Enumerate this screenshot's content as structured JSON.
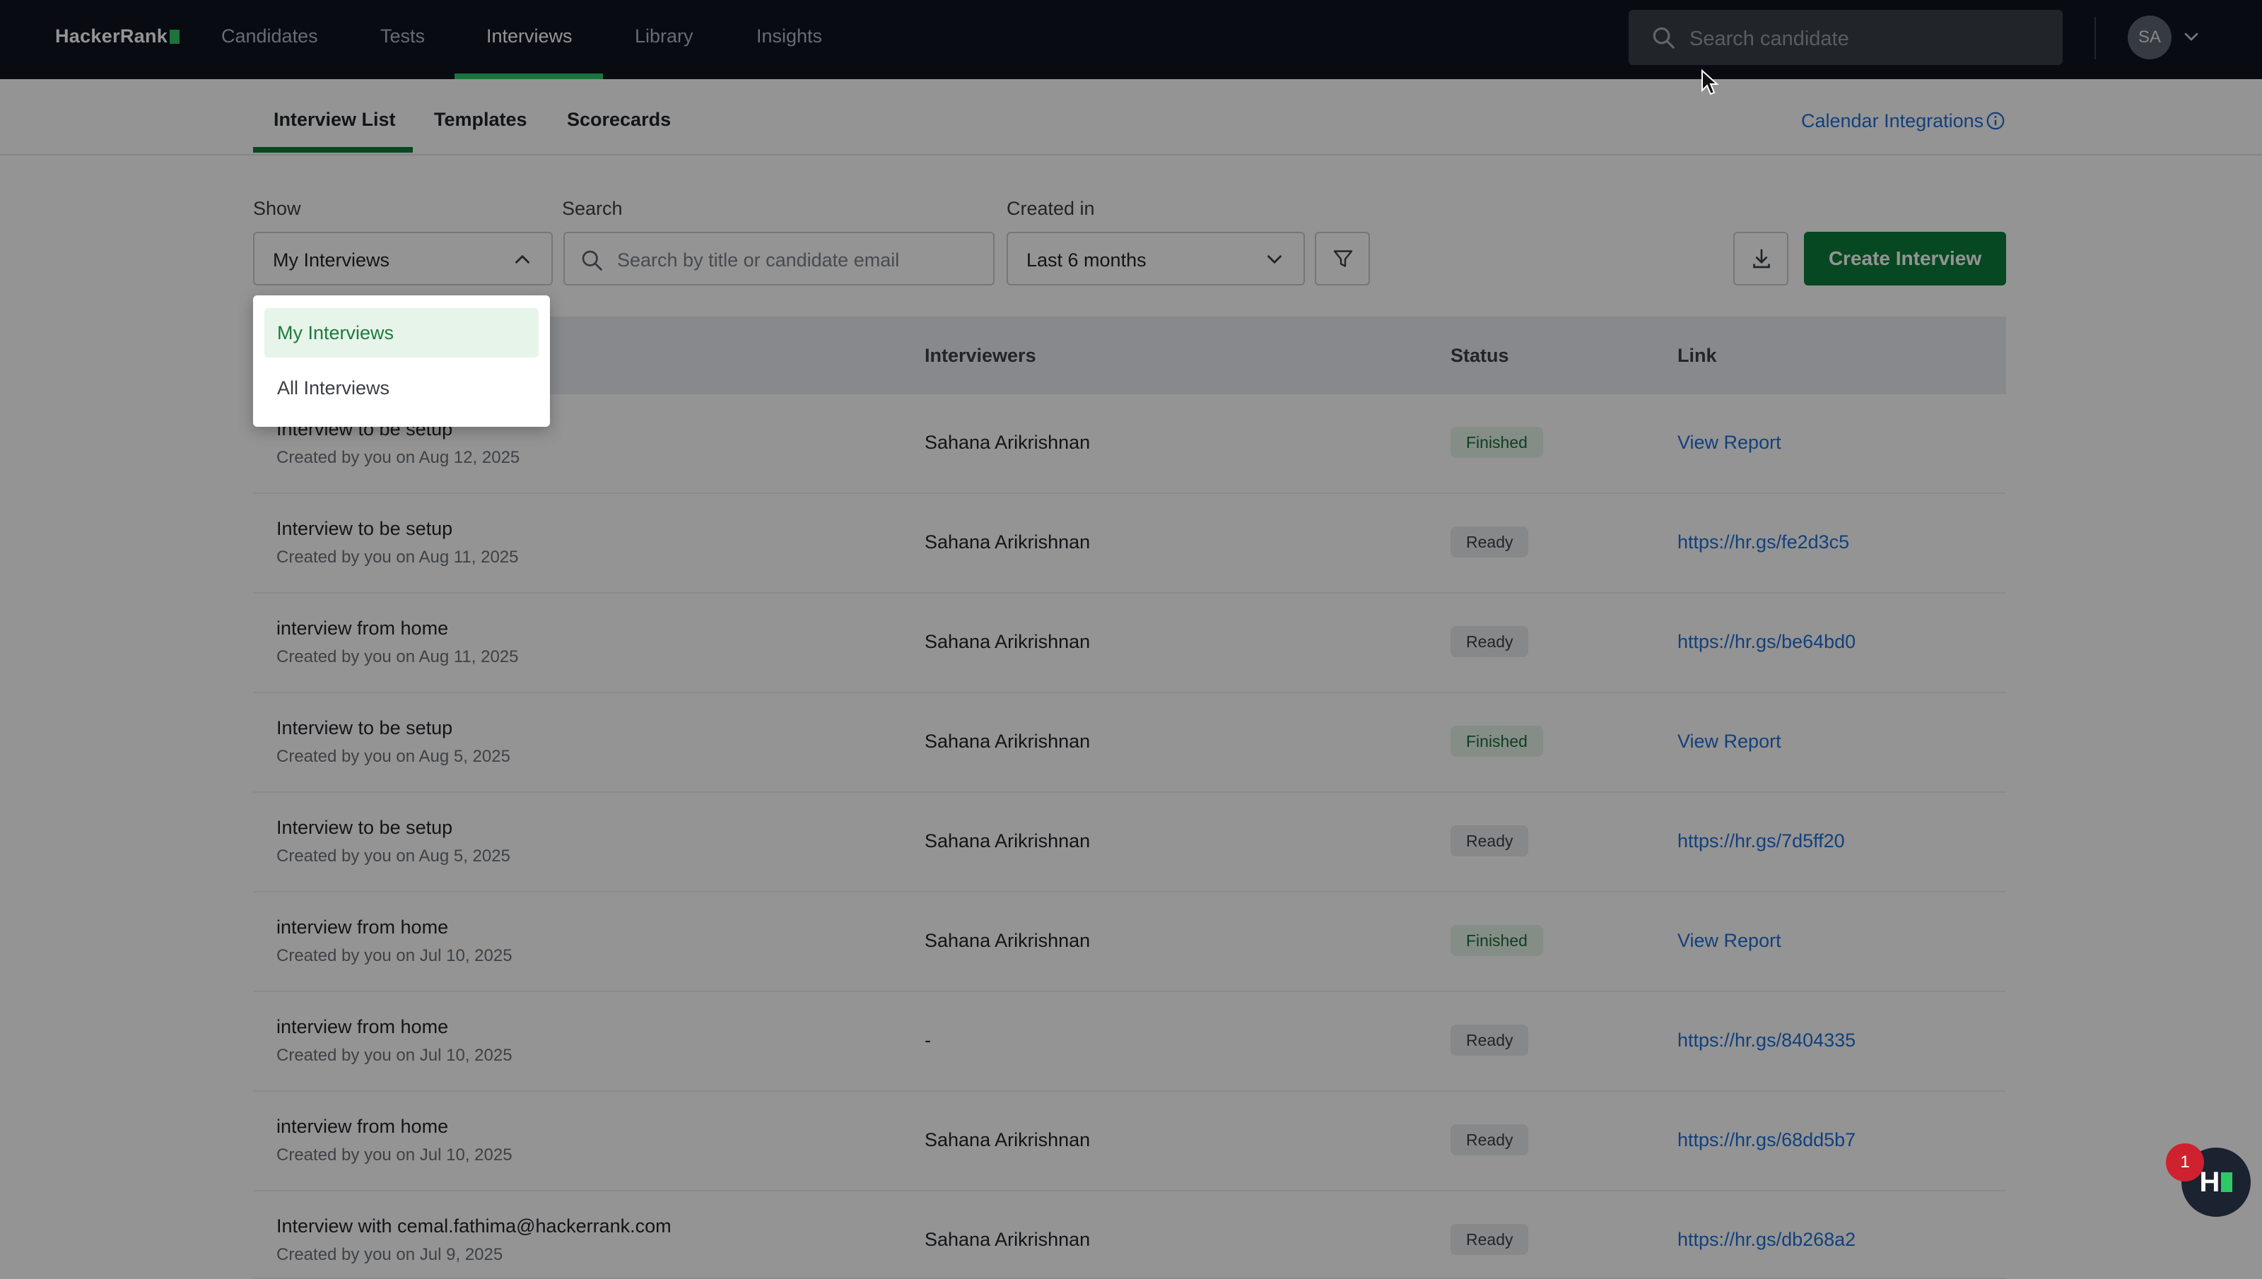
{
  "brand": {
    "name": "HackerRank"
  },
  "nav": {
    "items": [
      "Candidates",
      "Tests",
      "Interviews",
      "Library",
      "Insights"
    ],
    "active": "Interviews",
    "search_placeholder": "Search candidate",
    "avatar_initials": "SA"
  },
  "subtabs": {
    "items": [
      "Interview List",
      "Templates",
      "Scorecards"
    ],
    "active": "Interview List",
    "calendar_link": "Calendar Integrations"
  },
  "filters": {
    "show_label": "Show",
    "show_value": "My Interviews",
    "search_label": "Search",
    "search_placeholder": "Search by title or candidate email",
    "created_label": "Created in",
    "created_value": "Last 6 months",
    "create_button": "Create Interview"
  },
  "dropdown": {
    "options": [
      "My Interviews",
      "All Interviews"
    ],
    "selected": "My Interviews"
  },
  "table": {
    "columns": [
      "Interviewers",
      "Status",
      "Link"
    ],
    "rows": [
      {
        "title": "Interview to be setup",
        "created": "Created by you on Aug 12, 2025",
        "interviewer": "Sahana Arikrishnan",
        "status": "Finished",
        "link": "View Report"
      },
      {
        "title": "Interview to be setup",
        "created": "Created by you on Aug 11, 2025",
        "interviewer": "Sahana Arikrishnan",
        "status": "Ready",
        "link": "https://hr.gs/fe2d3c5"
      },
      {
        "title": "interview from home",
        "created": "Created by you on Aug 11, 2025",
        "interviewer": "Sahana Arikrishnan",
        "status": "Ready",
        "link": "https://hr.gs/be64bd0"
      },
      {
        "title": "Interview to be setup",
        "created": "Created by you on Aug 5, 2025",
        "interviewer": "Sahana Arikrishnan",
        "status": "Finished",
        "link": "View Report"
      },
      {
        "title": "Interview to be setup",
        "created": "Created by you on Aug 5, 2025",
        "interviewer": "Sahana Arikrishnan",
        "status": "Ready",
        "link": "https://hr.gs/7d5ff20"
      },
      {
        "title": "interview from home",
        "created": "Created by you on Jul 10, 2025",
        "interviewer": "Sahana Arikrishnan",
        "status": "Finished",
        "link": "View Report"
      },
      {
        "title": "interview from home",
        "created": "Created by you on Jul 10, 2025",
        "interviewer": "-",
        "status": "Ready",
        "link": "https://hr.gs/8404335"
      },
      {
        "title": "interview from home",
        "created": "Created by you on Jul 10, 2025",
        "interviewer": "Sahana Arikrishnan",
        "status": "Ready",
        "link": "https://hr.gs/68dd5b7"
      },
      {
        "title": "Interview with cemal.fathima@hackerrank.com",
        "created": "Created by you on Jul 9, 2025",
        "interviewer": "Sahana Arikrishnan",
        "status": "Ready",
        "link": "https://hr.gs/db268a2"
      }
    ]
  },
  "help_widget": {
    "badge_count": "1",
    "label": "H"
  },
  "colors": {
    "nav_bg": "#0e141e",
    "brand_green": "#2ec866",
    "primary_button": "#0c7c3a",
    "link": "#1f6fd6"
  }
}
